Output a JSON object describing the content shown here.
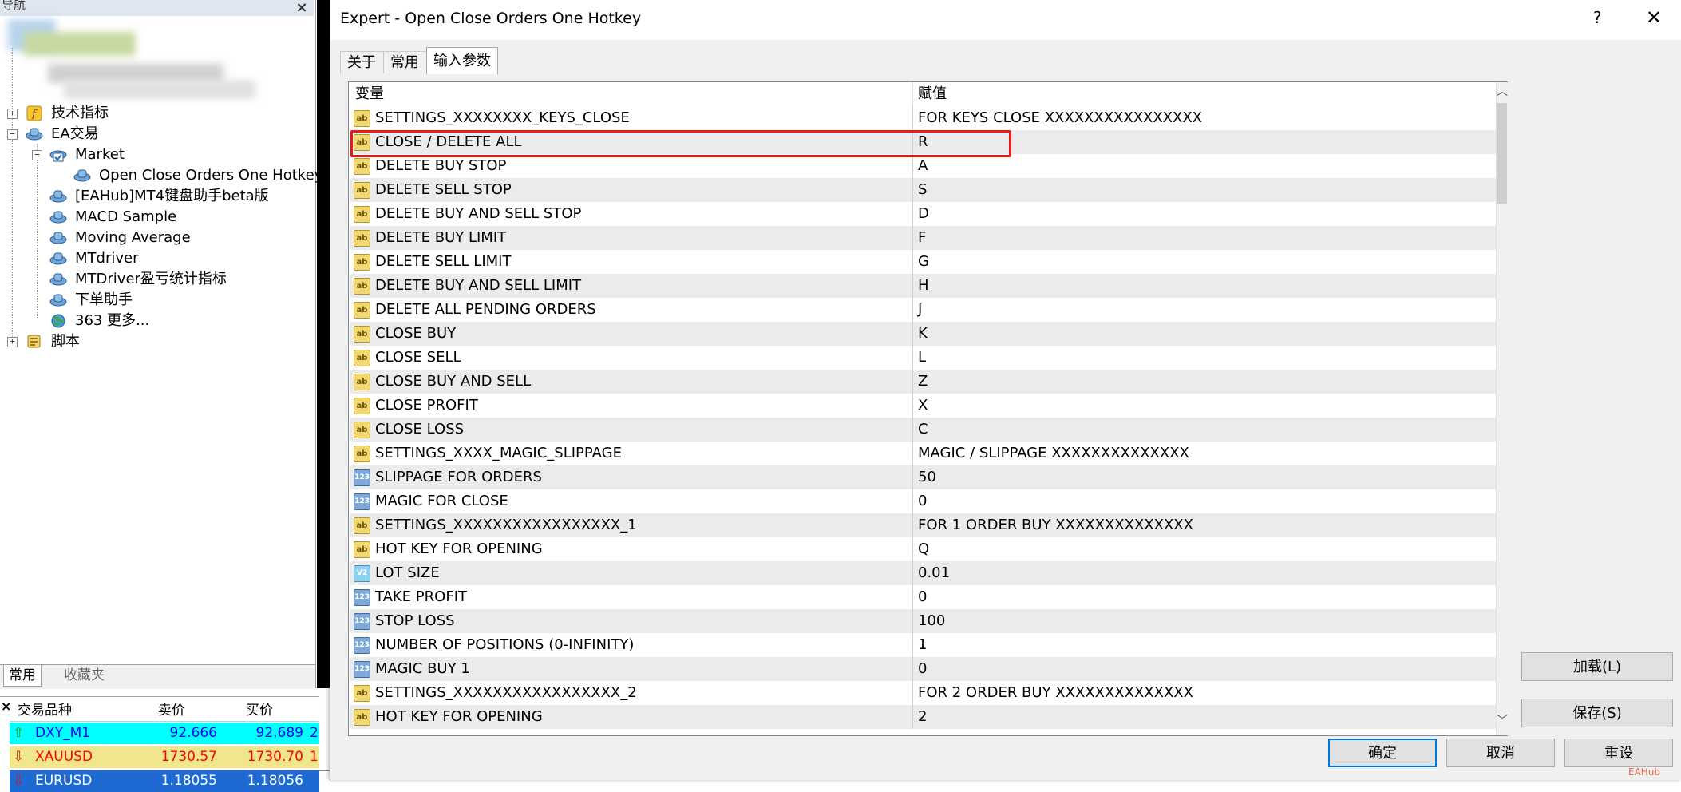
{
  "navigator": {
    "title": "导航",
    "tree": [
      {
        "label": "技术指标",
        "icon": "function-icon"
      },
      {
        "label": "EA交易",
        "icon": "expert-hat-icon"
      },
      {
        "label": "Market",
        "icon": "market-icon"
      },
      {
        "label": "Open Close Orders One Hotkey",
        "icon": "expert-hat-icon"
      },
      {
        "label": "[EAHub]MT4键盘助手beta版",
        "icon": "expert-hat-icon"
      },
      {
        "label": "MACD Sample",
        "icon": "expert-hat-icon"
      },
      {
        "label": "Moving Average",
        "icon": "expert-hat-icon"
      },
      {
        "label": "MTdriver",
        "icon": "expert-hat-icon"
      },
      {
        "label": "MTDriver盈亏统计指标",
        "icon": "expert-hat-icon"
      },
      {
        "label": "下单助手",
        "icon": "expert-hat-icon"
      },
      {
        "label": "363 更多...",
        "icon": "globe-icon"
      },
      {
        "label": "脚本",
        "icon": "script-icon"
      }
    ],
    "tabs": [
      "常用",
      "收藏夹"
    ]
  },
  "market_watch": {
    "headers": [
      "交易品种",
      "卖价",
      "买价"
    ],
    "rows": [
      {
        "symbol": "DXY_M1",
        "bid": "92.666",
        "ask": "92.689",
        "extra": "2",
        "direction": "up",
        "bg": "#00ffff",
        "color": "#0000ff"
      },
      {
        "symbol": "XAUUSD",
        "bid": "1730.57",
        "ask": "1730.70",
        "extra": "1",
        "direction": "down",
        "bg": "#f0e68c",
        "color": "#ff0000"
      },
      {
        "symbol": "EURUSD",
        "bid": "1.18055",
        "ask": "1.18056",
        "extra": "",
        "direction": "down",
        "bg": "#1e6ad2",
        "color": "#ffffff"
      }
    ]
  },
  "dialog": {
    "title": "Expert - Open Close Orders One Hotkey",
    "help": "?",
    "close": "✕",
    "tabs": [
      "关于",
      "常用",
      "输入参数"
    ],
    "active_tab": "输入参数",
    "columns": [
      "变量",
      "赋值"
    ],
    "params": [
      {
        "type": "ab",
        "name": "SETTINGS_XXXXXXXX_KEYS_CLOSE",
        "value": "FOR KEYS CLOSE XXXXXXXXXXXXXXXX"
      },
      {
        "type": "ab",
        "name": "CLOSE / DELETE ALL",
        "value": "R"
      },
      {
        "type": "ab",
        "name": "DELETE BUY STOP",
        "value": "A"
      },
      {
        "type": "ab",
        "name": "DELETE SELL STOP",
        "value": "S"
      },
      {
        "type": "ab",
        "name": "DELETE BUY AND SELL STOP",
        "value": "D"
      },
      {
        "type": "ab",
        "name": "DELETE BUY LIMIT",
        "value": "F"
      },
      {
        "type": "ab",
        "name": "DELETE SELL LIMIT",
        "value": "G"
      },
      {
        "type": "ab",
        "name": "DELETE BUY AND SELL LIMIT",
        "value": "H"
      },
      {
        "type": "ab",
        "name": "DELETE ALL PENDING ORDERS",
        "value": "J"
      },
      {
        "type": "ab",
        "name": "CLOSE BUY",
        "value": "K"
      },
      {
        "type": "ab",
        "name": "CLOSE SELL",
        "value": "L"
      },
      {
        "type": "ab",
        "name": "CLOSE BUY AND SELL",
        "value": "Z"
      },
      {
        "type": "ab",
        "name": "CLOSE PROFIT",
        "value": "X"
      },
      {
        "type": "ab",
        "name": "CLOSE LOSS",
        "value": "C"
      },
      {
        "type": "ab",
        "name": "SETTINGS_XXXX_MAGIC_SLIPPAGE",
        "value": "MAGIC / SLIPPAGE XXXXXXXXXXXXXX"
      },
      {
        "type": "123",
        "name": "SLIPPAGE FOR ORDERS",
        "value": "50"
      },
      {
        "type": "123",
        "name": "MAGIC FOR CLOSE",
        "value": "0"
      },
      {
        "type": "ab",
        "name": "SETTINGS_XXXXXXXXXXXXXXXXX_1",
        "value": "FOR 1 ORDER BUY  XXXXXXXXXXXXXX"
      },
      {
        "type": "ab",
        "name": "HOT KEY FOR OPENING",
        "value": "Q"
      },
      {
        "type": "v2",
        "name": "LOT SIZE",
        "value": "0.01"
      },
      {
        "type": "123",
        "name": "TAKE PROFIT",
        "value": "0"
      },
      {
        "type": "123",
        "name": "STOP LOSS",
        "value": "100"
      },
      {
        "type": "123",
        "name": "NUMBER OF POSITIONS (0-INFINITY)",
        "value": "1"
      },
      {
        "type": "123",
        "name": "MAGIC BUY 1",
        "value": "0"
      },
      {
        "type": "ab",
        "name": "SETTINGS_XXXXXXXXXXXXXXXXX_2",
        "value": "FOR 2 ORDER BUY  XXXXXXXXXXXXXX"
      },
      {
        "type": "ab",
        "name": "HOT KEY FOR OPENING",
        "value": "2"
      }
    ],
    "icon_text": {
      "ab": "ab",
      "123": "123",
      "v2": "V2"
    },
    "highlight_color": "#e81b1b",
    "buttons": {
      "load": "加载(L)",
      "save": "保存(S)",
      "ok": "确定",
      "cancel": "取消",
      "reset": "重设"
    }
  },
  "watermark": "EAHub"
}
